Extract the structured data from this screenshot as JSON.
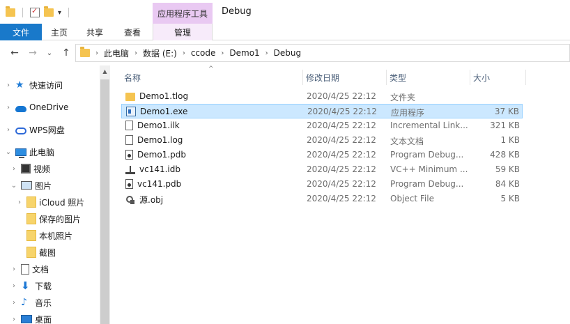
{
  "window": {
    "context_tab_label": "应用程序工具",
    "title": "Debug"
  },
  "ribbon": {
    "file": "文件",
    "home": "主页",
    "share": "共享",
    "view": "查看",
    "manage": "管理"
  },
  "address": {
    "crumbs": [
      "此电脑",
      "数据 (E:)",
      "ccode",
      "Demo1",
      "Debug"
    ]
  },
  "nav": {
    "items": [
      {
        "label": "快速访问",
        "icon": "star-icon"
      },
      {
        "label": "OneDrive",
        "icon": "cloud-icon"
      },
      {
        "label": "WPS网盘",
        "icon": "wps-cloud-icon"
      },
      {
        "label": "此电脑",
        "icon": "computer-icon"
      },
      {
        "label": "视频",
        "icon": "video-icon"
      },
      {
        "label": "图片",
        "icon": "pictures-icon"
      },
      {
        "label": "iCloud 照片",
        "icon": "folder-icon"
      },
      {
        "label": "保存的图片",
        "icon": "folder-icon"
      },
      {
        "label": "本机照片",
        "icon": "folder-icon"
      },
      {
        "label": "截图",
        "icon": "folder-icon"
      },
      {
        "label": "文档",
        "icon": "document-icon"
      },
      {
        "label": "下载",
        "icon": "download-icon"
      },
      {
        "label": "音乐",
        "icon": "music-icon"
      },
      {
        "label": "桌面",
        "icon": "desktop-icon"
      }
    ]
  },
  "columns": {
    "name": "名称",
    "date": "修改日期",
    "type": "类型",
    "size": "大小"
  },
  "files": [
    {
      "name": "Demo1.tlog",
      "date": "2020/4/25 22:12",
      "type": "文件夹",
      "size": "",
      "icon": "folder-icon"
    },
    {
      "name": "Demo1.exe",
      "date": "2020/4/25 22:12",
      "type": "应用程序",
      "size": "37 KB",
      "icon": "exe-icon"
    },
    {
      "name": "Demo1.ilk",
      "date": "2020/4/25 22:12",
      "type": "Incremental Link...",
      "size": "321 KB",
      "icon": "ilk-file-icon"
    },
    {
      "name": "Demo1.log",
      "date": "2020/4/25 22:12",
      "type": "文本文档",
      "size": "1 KB",
      "icon": "text-file-icon"
    },
    {
      "name": "Demo1.pdb",
      "date": "2020/4/25 22:12",
      "type": "Program Debug...",
      "size": "428 KB",
      "icon": "pdb-file-icon"
    },
    {
      "name": "vc141.idb",
      "date": "2020/4/25 22:12",
      "type": "VC++ Minimum ...",
      "size": "59 KB",
      "icon": "idb-file-icon"
    },
    {
      "name": "vc141.pdb",
      "date": "2020/4/25 22:12",
      "type": "Program Debug...",
      "size": "84 KB",
      "icon": "pdb-file-icon"
    },
    {
      "name": "源.obj",
      "date": "2020/4/25 22:12",
      "type": "Object File",
      "size": "5 KB",
      "icon": "obj-file-icon"
    }
  ]
}
